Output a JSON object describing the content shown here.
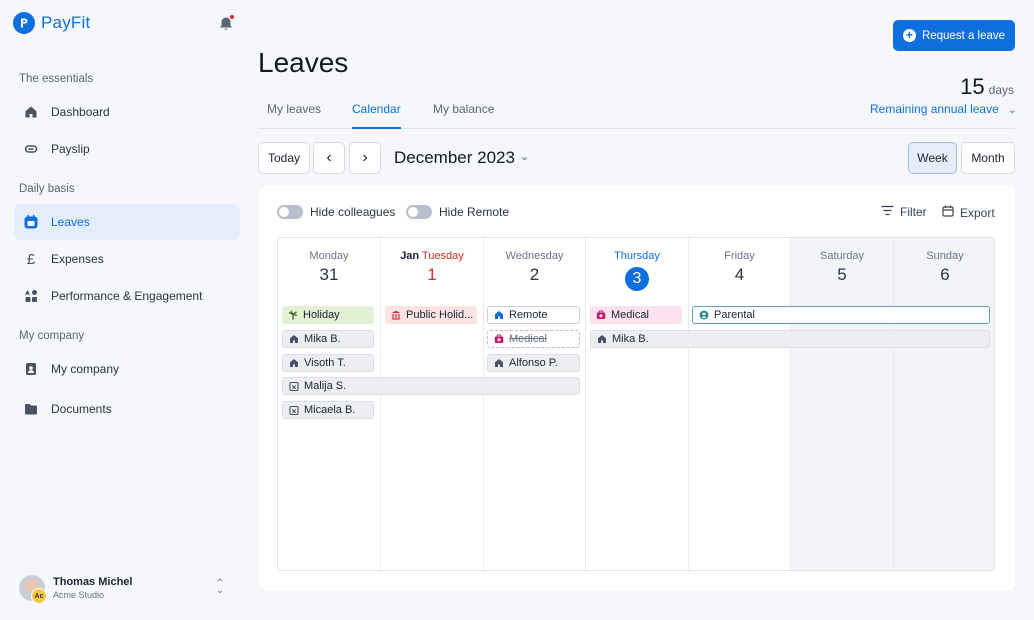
{
  "app": {
    "name": "PayFit"
  },
  "sidebar": {
    "sections": [
      {
        "label": "The essentials"
      },
      {
        "label": "Daily basis"
      },
      {
        "label": "My company"
      }
    ],
    "items": [
      {
        "label": "Dashboard",
        "icon": "home-icon"
      },
      {
        "label": "Payslip",
        "icon": "payslip-icon"
      },
      {
        "label": "Leaves",
        "icon": "calendar-icon",
        "active": true
      },
      {
        "label": "Expenses",
        "icon": "pound-icon"
      },
      {
        "label": "Performance & Engagement",
        "icon": "shapes-icon"
      },
      {
        "label": "My company",
        "icon": "building-icon"
      },
      {
        "label": "Documents",
        "icon": "folder-icon"
      }
    ],
    "user": {
      "name": "Thomas Michel",
      "company": "Acme Studio",
      "badge": "Ac"
    }
  },
  "header": {
    "title": "Leaves",
    "request_button": "Request a leave",
    "balance_number": "15",
    "balance_unit": "days",
    "balance_link": "Remaining annual leave"
  },
  "tabs": [
    {
      "label": "My leaves"
    },
    {
      "label": "Calendar",
      "active": true
    },
    {
      "label": "My balance"
    }
  ],
  "toolbar": {
    "today": "Today",
    "prev": "‹",
    "next": "›",
    "month": "December 2023",
    "week": "Week",
    "month_view": "Month",
    "view_selected": "Week"
  },
  "filters": {
    "hide_colleagues": "Hide colleagues",
    "hide_remote": "Hide Remote",
    "filter": "Filter",
    "export": "Export"
  },
  "calendar": {
    "days": [
      {
        "name": "Monday",
        "num": "31"
      },
      {
        "prefix": "Jan",
        "name": "Tuesday",
        "num": "1",
        "public_holiday": true
      },
      {
        "name": "Wednesday",
        "num": "2"
      },
      {
        "name": "Thursday",
        "num": "3",
        "today": true
      },
      {
        "name": "Friday",
        "num": "4"
      },
      {
        "name": "Saturday",
        "num": "5",
        "weekend": true
      },
      {
        "name": "Sunday",
        "num": "6",
        "weekend": true
      }
    ],
    "events": [
      {
        "label": "Holiday",
        "type": "holiday",
        "icon": "palm-icon"
      },
      {
        "label": "Mika B.",
        "type": "remote-colleague",
        "icon": "home-icon"
      },
      {
        "label": "Visoth T.",
        "type": "remote-colleague",
        "icon": "home-icon"
      },
      {
        "label": "Malija S.",
        "type": "leave-colleague",
        "icon": "calendar-x-icon"
      },
      {
        "label": "Micaela B.",
        "type": "leave-colleague",
        "icon": "calendar-x-icon"
      },
      {
        "label": "Public Holid...",
        "type": "public-holiday",
        "icon": "bank-icon"
      },
      {
        "label": "Remote",
        "type": "remote",
        "icon": "home-icon"
      },
      {
        "label": "Medical",
        "type": "medical-cancelled",
        "icon": "medical-icon"
      },
      {
        "label": "Alfonso P.",
        "type": "remote-colleague",
        "icon": "home-icon"
      },
      {
        "label": "Medical",
        "type": "medical",
        "icon": "medical-icon"
      },
      {
        "label": "Mika B.",
        "type": "remote-colleague",
        "icon": "home-icon"
      },
      {
        "label": "Parental",
        "type": "parental",
        "icon": "baby-icon"
      }
    ]
  },
  "colors": {
    "primary": "#0f6fde",
    "holiday_bg": "#e2f0d4",
    "public_holiday_bg": "#fbe3e3",
    "medical_bg": "#fce2ee",
    "parental_border": "#5aa5a5",
    "public_holiday_text": "#d22c2c"
  }
}
